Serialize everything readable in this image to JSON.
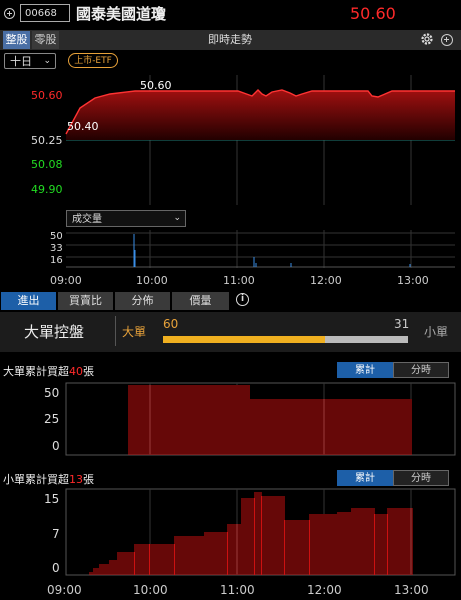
{
  "header": {
    "stock_code": "00668",
    "stock_name": "國泰美國道瓊",
    "price": "50.60"
  },
  "tabs": {
    "whole_lot": "整股",
    "odd_lot": "零股",
    "title": "即時走勢"
  },
  "range_select": "十日",
  "market_badge": "上市-ETF",
  "price_chart": {
    "y_labels": [
      "50.60",
      "50.25",
      "50.08",
      "49.90"
    ],
    "high_label": "50.60",
    "low_label": "50.40"
  },
  "volume_chart": {
    "select_label": "成交量",
    "y_labels": [
      "50",
      "33",
      "16"
    ]
  },
  "x_labels": [
    "09:00",
    "10:00",
    "11:00",
    "12:00",
    "13:00"
  ],
  "section_tabs": [
    "進出",
    "買賣比",
    "分佈",
    "價量"
  ],
  "control": {
    "title": "大單控盤",
    "big_label": "大單",
    "small_label": "小單",
    "big_value": "60",
    "small_value": "31",
    "big_fraction": 0.66
  },
  "big_chart": {
    "title_prefix": "大單累計買超",
    "title_value": "40",
    "title_suffix": "張",
    "seg_active": "累計",
    "seg_inactive": "分時",
    "y_labels": [
      "50",
      "25",
      "0"
    ]
  },
  "small_chart": {
    "title_prefix": "小單累計買超",
    "title_value": "13",
    "title_suffix": "張",
    "seg_active": "累計",
    "seg_inactive": "分時",
    "y_labels": [
      "15",
      "7",
      "0"
    ]
  },
  "colors": {
    "up": "#ff2a2a",
    "down": "#22dd22",
    "accent": "#e8a23a",
    "bar_red": "#cc1111",
    "active_tab": "#1d5fa8"
  }
}
